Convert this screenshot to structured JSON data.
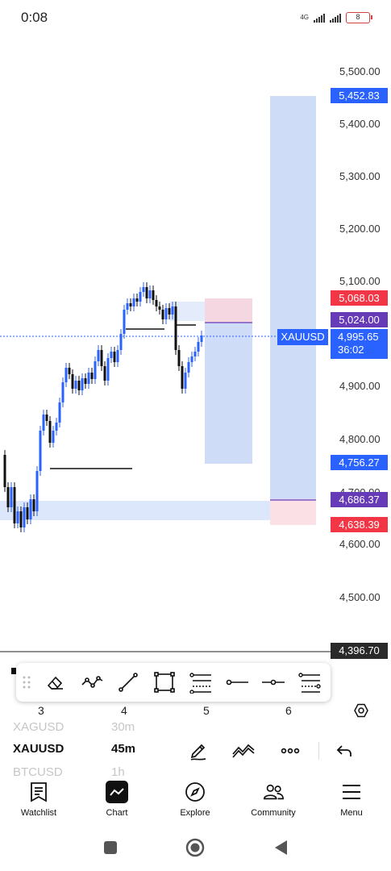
{
  "status_bar": {
    "time": "0:08",
    "network": "4G",
    "battery": "8"
  },
  "chart": {
    "price_scale": [
      "5,500.00",
      "5,400.00",
      "5,300.00",
      "5,200.00",
      "5,100.00",
      "4,900.00",
      "4,800.00",
      "4,700.00",
      "4,600.00",
      "4,500.00"
    ],
    "symbol_label": "XAUUSD",
    "current_price": "4,995.65",
    "countdown": "36:02",
    "price_tags": {
      "long_target": "5,452.83",
      "short_stop": "5,068.03",
      "short_entry": "5,024.00",
      "short_target": "4,756.27",
      "long_entry": "4,686.37",
      "long_stop": "4,638.39"
    },
    "crosshair_price": "4,396.70",
    "x_axis": [
      "3",
      "4",
      "5",
      "6"
    ],
    "colors": {
      "up": "#2962ff",
      "down": "#111111",
      "target_zone": "#cfdcf8",
      "stop_zone": "#f8d7dc",
      "accent": "#2962ff",
      "loss": "#f23645",
      "entry": "#673ab7"
    }
  },
  "drawing_toolbar": {
    "tools": [
      "grip-icon",
      "eraser-icon",
      "path-icon",
      "trendline-icon",
      "rectangle-icon",
      "fib-retracement-icon",
      "horizontal-ray-icon",
      "horizontal-line-icon",
      "multi-level-icon"
    ]
  },
  "symbol_row": {
    "prev_symbol": "XAGUSD",
    "prev_timeframe": "30m",
    "symbol": "XAUUSD",
    "timeframe": "45m",
    "next_symbol": "BTCUSD",
    "next_timeframe": "1h"
  },
  "bottom_nav": [
    "Watchlist",
    "Chart",
    "Explore",
    "Community",
    "Menu"
  ]
}
